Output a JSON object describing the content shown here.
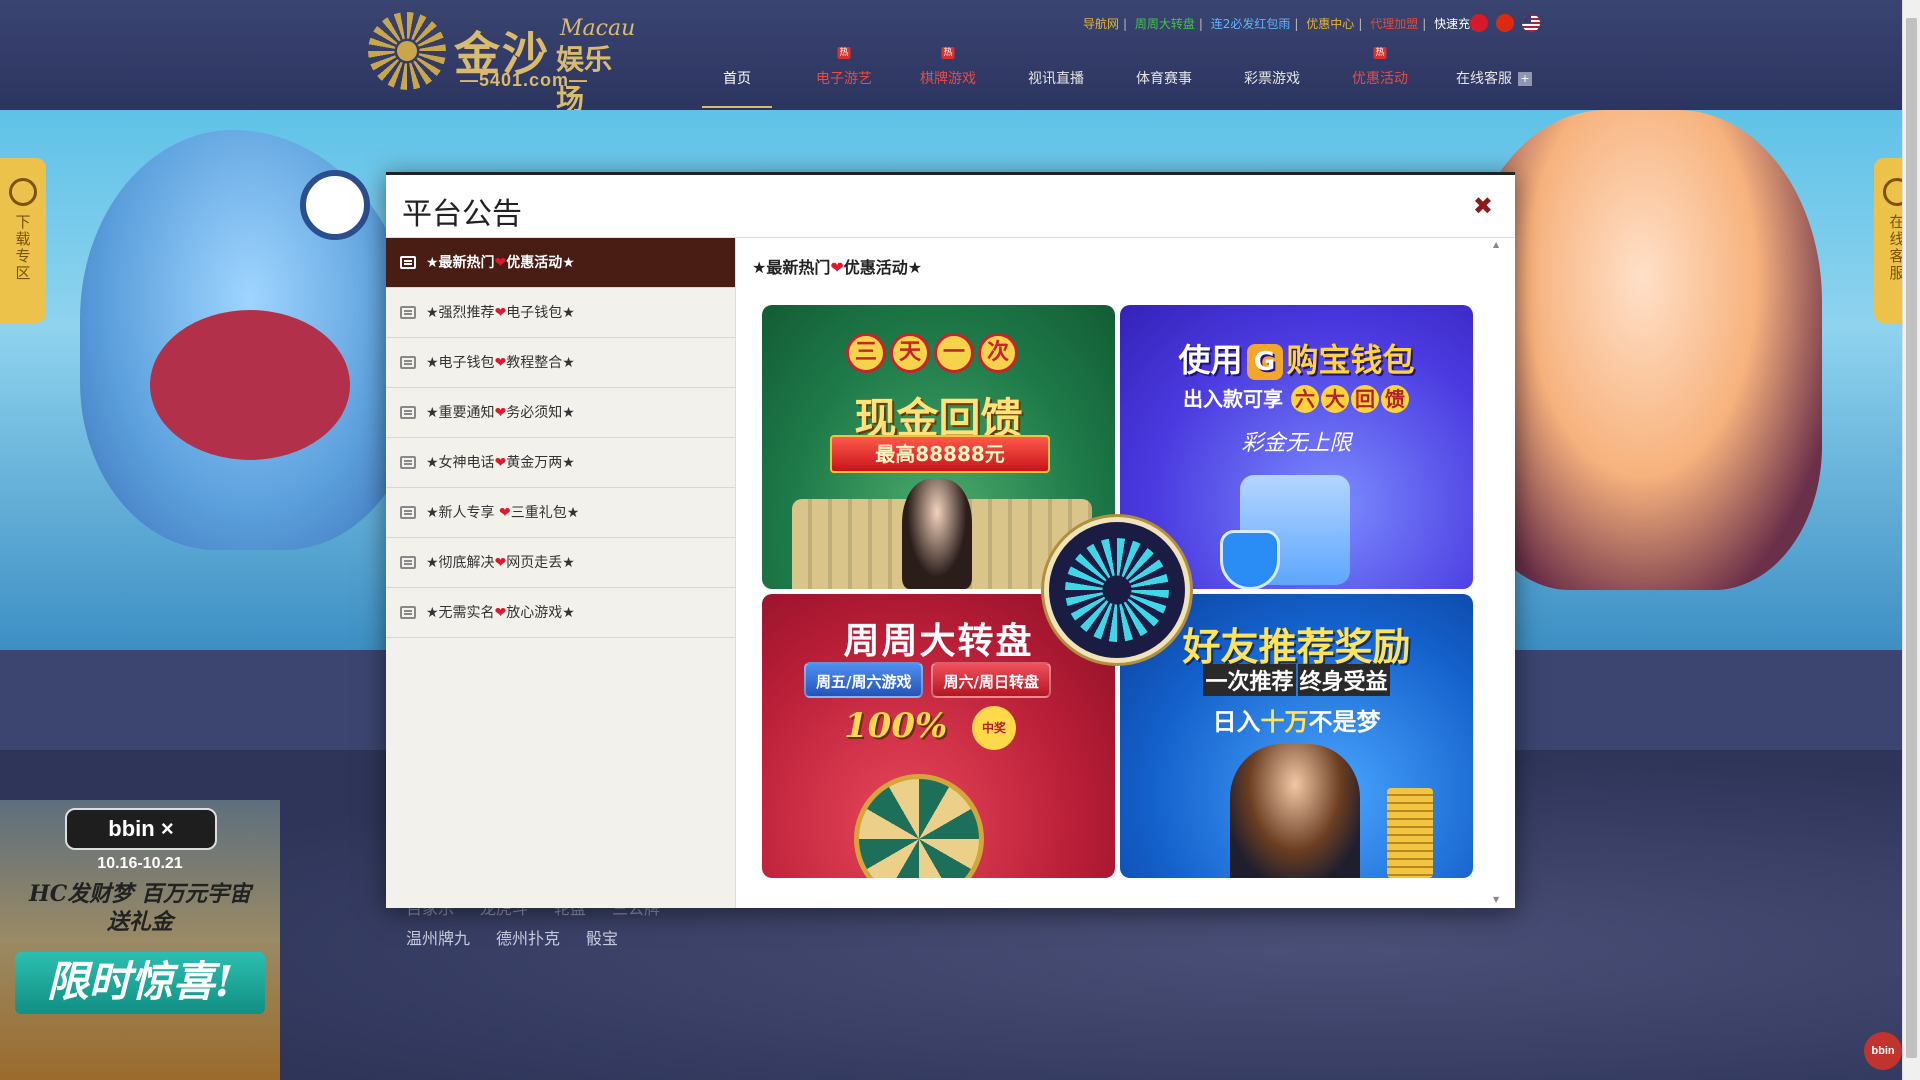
{
  "header": {
    "logo": {
      "cn_title": "金沙",
      "cn_subtitle": "娱乐场",
      "macau": "Macau",
      "domain": "—5401.com—"
    },
    "top_links": [
      {
        "label": "导航网",
        "color": "#e0b43a"
      },
      {
        "label": "周周大转盘",
        "color": "#43c24a"
      },
      {
        "label": "连2必发红包雨",
        "color": "#5fb4ff"
      },
      {
        "label": "优惠中心",
        "color": "#e0b43a"
      },
      {
        "label": "代理加盟",
        "color": "#e04a3a"
      },
      {
        "label": "快速充值",
        "color": "#ffffff"
      }
    ],
    "flags": [
      "hk-flag-icon",
      "cn-flag-icon",
      "us-flag-icon"
    ],
    "nav": [
      {
        "label": "首页",
        "hot": false,
        "active": true
      },
      {
        "label": "电子游艺",
        "hot": true,
        "active": false
      },
      {
        "label": "棋牌游戏",
        "hot": true,
        "active": false
      },
      {
        "label": "视讯直播",
        "hot": false,
        "active": false
      },
      {
        "label": "体育赛事",
        "hot": false,
        "active": false
      },
      {
        "label": "彩票游戏",
        "hot": false,
        "active": false
      },
      {
        "label": "优惠活动",
        "hot": true,
        "active": false
      },
      {
        "label": "在线客服",
        "hot": false,
        "active": false
      }
    ],
    "hot_badge": "热"
  },
  "sidetabs": {
    "left": "下载专区",
    "right": "在线客服"
  },
  "games": {
    "row1": [
      "百家乐",
      "龙虎斗",
      "轮盘",
      "三公牌"
    ],
    "row2": [
      "温州牌九",
      "德州扑克",
      "骰宝"
    ]
  },
  "ad_left": {
    "brand": "bbin ×",
    "date": "10.16-10.21",
    "line1": "HC发财梦 百万元宇宙",
    "line2": "送礼金",
    "line3": "限时惊喜!"
  },
  "corner_badge": "bbin",
  "modal": {
    "title": "平台公告",
    "close": "✖",
    "tabs": [
      {
        "pre": "★最新热门",
        "post": "优惠活动★",
        "active": true
      },
      {
        "pre": "★强烈推荐",
        "post": "电子钱包★",
        "active": false
      },
      {
        "pre": "★电子钱包",
        "post": "教程整合★",
        "active": false
      },
      {
        "pre": "★重要通知",
        "post": "务必须知★",
        "active": false
      },
      {
        "pre": "★女神电话",
        "post": "黄金万两★",
        "active": false
      },
      {
        "pre": "★新人专享 ",
        "post": "三重礼包★",
        "active": false
      },
      {
        "pre": "★彻底解决",
        "post": "网页走丢★",
        "active": false
      },
      {
        "pre": "★无需实名",
        "post": "放心游戏★",
        "active": false
      }
    ],
    "heart": "❤",
    "content_title": {
      "pre": "★最新热门",
      "post": "优惠活动★"
    },
    "promos": {
      "p1": {
        "chips": [
          "三",
          "天",
          "一",
          "次"
        ],
        "title": "现金回馈",
        "ribbon": "最高88888元"
      },
      "p2": {
        "title_pre": "使用",
        "logo": "G",
        "title_post": "购宝钱包",
        "sub_pre": "出入款可享",
        "sub_chips": [
          "六",
          "大",
          "回",
          "馈"
        ],
        "tagline": "彩金无上限"
      },
      "p3": {
        "title": "周周大转盘",
        "pill_a": "周五/周六游戏",
        "pill_b": "周六/周日转盘",
        "pct": "100%",
        "prize": "中奖"
      },
      "p4": {
        "title": "好友推荐奖励",
        "sub": [
          "一次推荐",
          "终身受益"
        ],
        "line_pre": "日入",
        "line_hl": "十万",
        "line_post": "不是梦"
      }
    }
  }
}
